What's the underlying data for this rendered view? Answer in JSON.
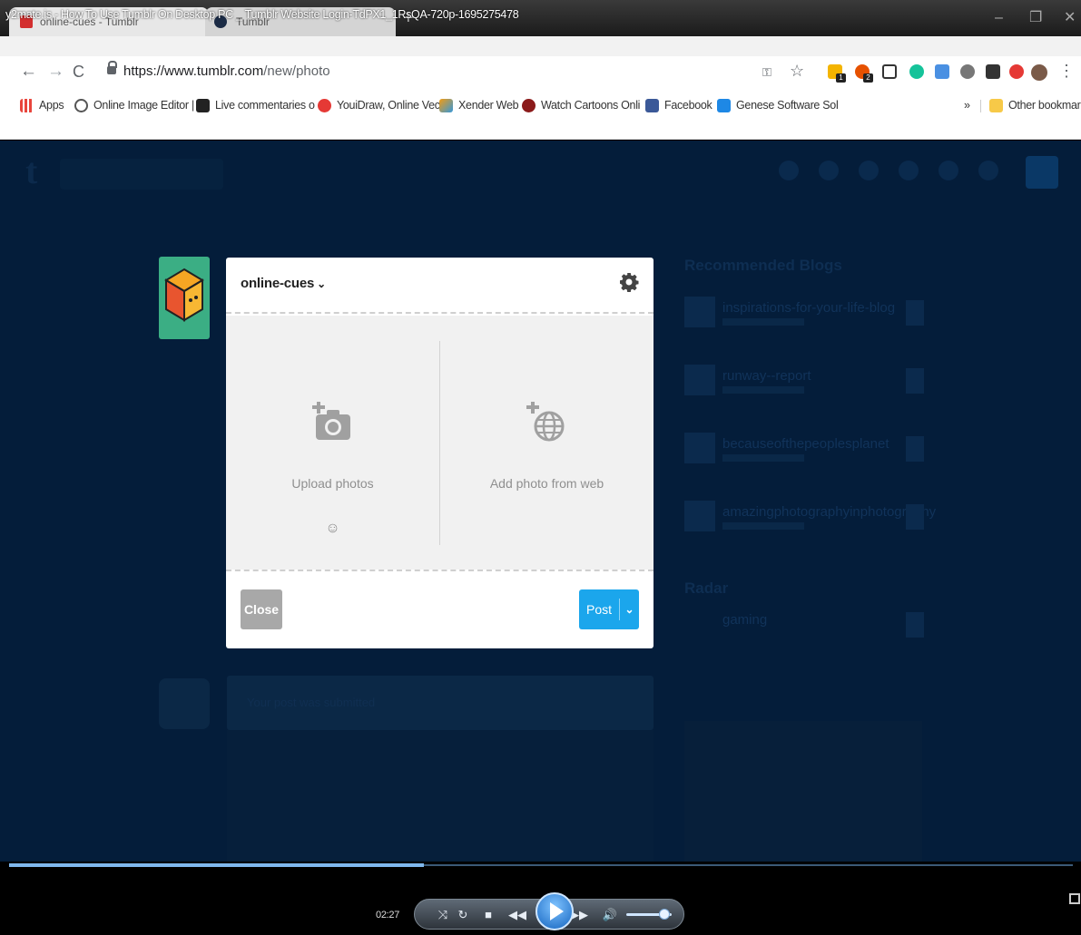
{
  "window": {
    "title": "y2mate.is - How To Use Tumblr On Desktop PC _ Tumblr Website Login-TdPX1_1RsQA-720p-1695275478",
    "tabs": [
      {
        "label": "online-cues - Tumblr"
      },
      {
        "label": "Tumblr"
      }
    ],
    "controls": {
      "minimize": "–",
      "restore": "❐",
      "close": "✕"
    }
  },
  "browser": {
    "url_host": "https://www.tumblr.com",
    "url_path": "/new/photo",
    "extension_badges": [
      "1",
      "2"
    ],
    "bookmarks": [
      {
        "label": "Apps",
        "icon": "apps-grid-icon",
        "color": "#e8453c"
      },
      {
        "label": "Online Image Editor |",
        "icon": "image-editor-icon",
        "color": "#555555"
      },
      {
        "label": "Live commentaries o",
        "icon": "commentary-icon",
        "color": "#222222"
      },
      {
        "label": "YouiDraw, Online Vec",
        "icon": "youidraw-icon",
        "color": "#e53935"
      },
      {
        "label": "Xender Web",
        "icon": "xender-icon",
        "color": "#f39c12"
      },
      {
        "label": "Watch Cartoons Onli",
        "icon": "cartoons-icon",
        "color": "#8b1a1a"
      },
      {
        "label": "Facebook",
        "icon": "facebook-icon",
        "color": "#3b5998"
      },
      {
        "label": "Genese Software Sol",
        "icon": "calendar-icon",
        "color": "#1e88e5"
      }
    ],
    "overflow_label": "»",
    "other_bookmarks": "Other bookmarks"
  },
  "tumblr": {
    "sidebar_title": "Recommended Blogs",
    "recommended": [
      {
        "name": "inspirations-for-your-life-blog"
      },
      {
        "name": "runway--report"
      },
      {
        "name": "becauseofthepeoplesplanet"
      },
      {
        "name": "amazingphotographyinphotography"
      }
    ],
    "radar_title": "Radar",
    "radar_name": "gaming",
    "background_post": "Your post was submitted"
  },
  "modal": {
    "blog_name": "online-cues",
    "upload_label": "Upload photos",
    "web_label": "Add photo from web",
    "smile": "☺",
    "close_label": "Close",
    "post_label": "Post"
  },
  "player": {
    "time": "02:27",
    "progress": 0.39
  }
}
